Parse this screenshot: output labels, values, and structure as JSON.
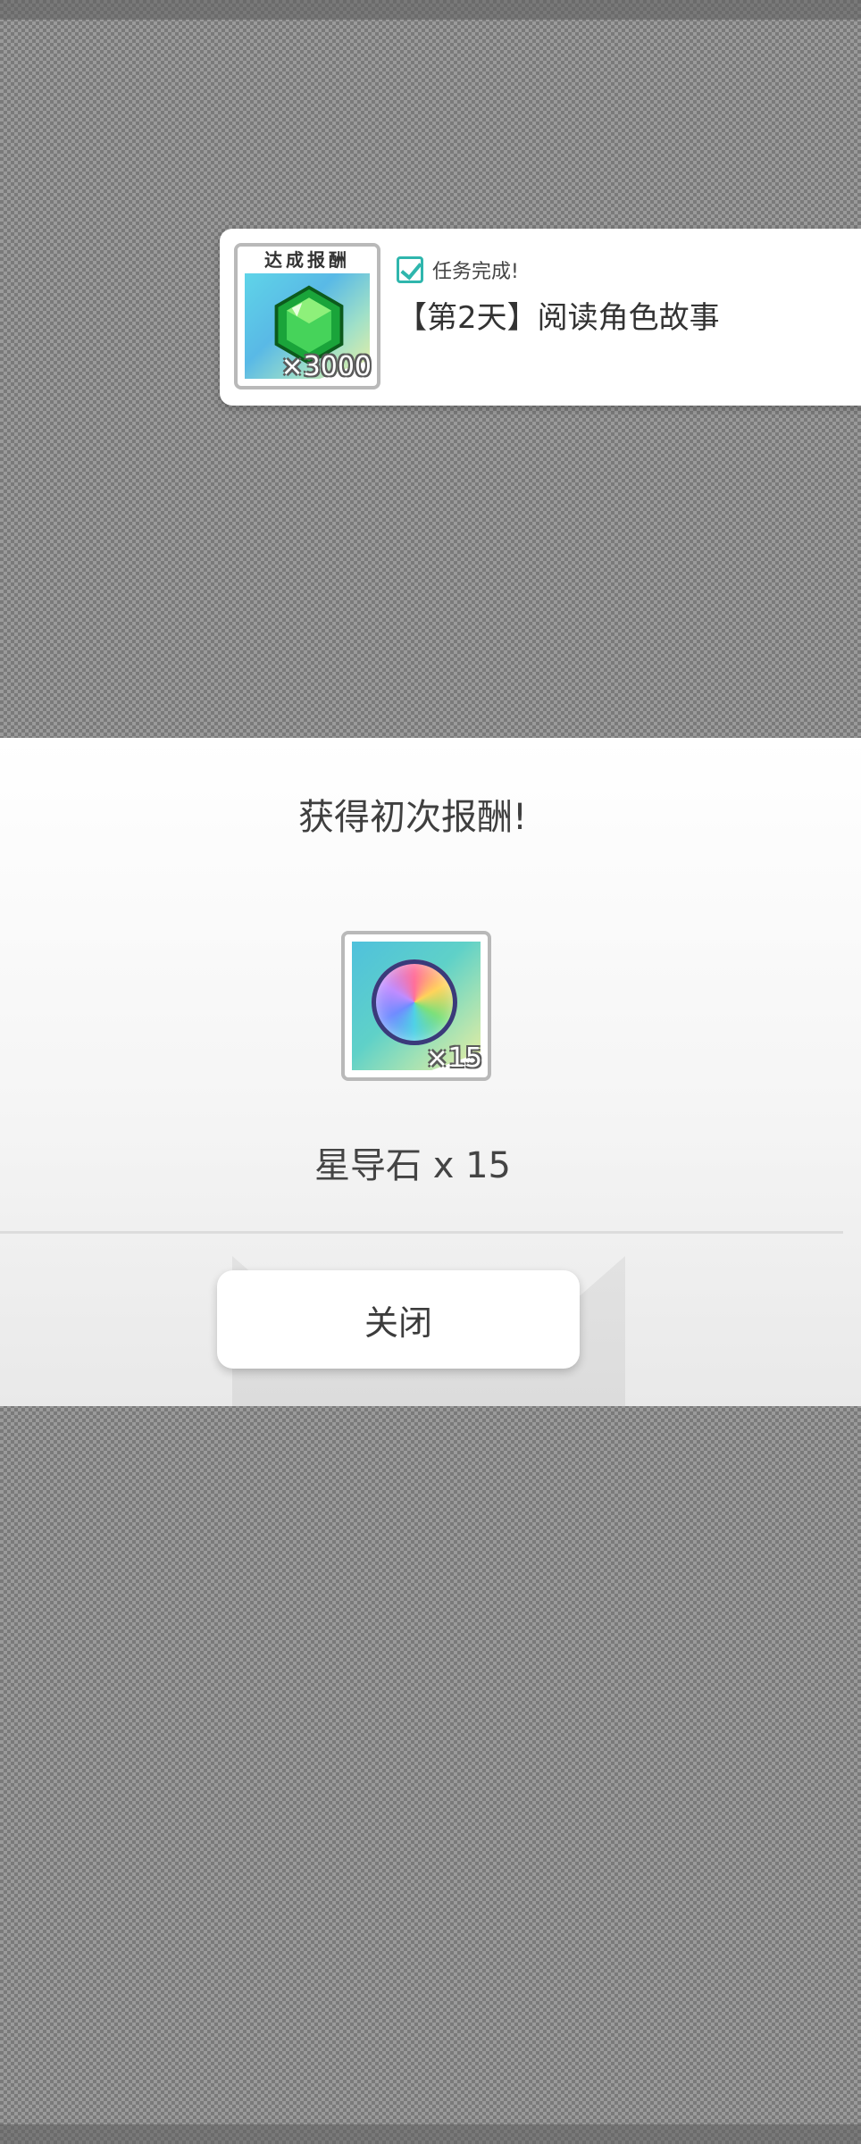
{
  "toast": {
    "badge_label": "达成报酬",
    "reward_count": "×3000",
    "status_text": "任务完成!",
    "mission_title": "【第2天】阅读角色故事",
    "icon": "emerald-gem-icon",
    "accent_color": "#2fb6ad"
  },
  "dialog": {
    "title": "获得初次报酬!",
    "reward_count": "×15",
    "reward_name": "星导石 x 15",
    "reward_icon": "rainbow-orb-icon",
    "close_label": "关闭"
  }
}
